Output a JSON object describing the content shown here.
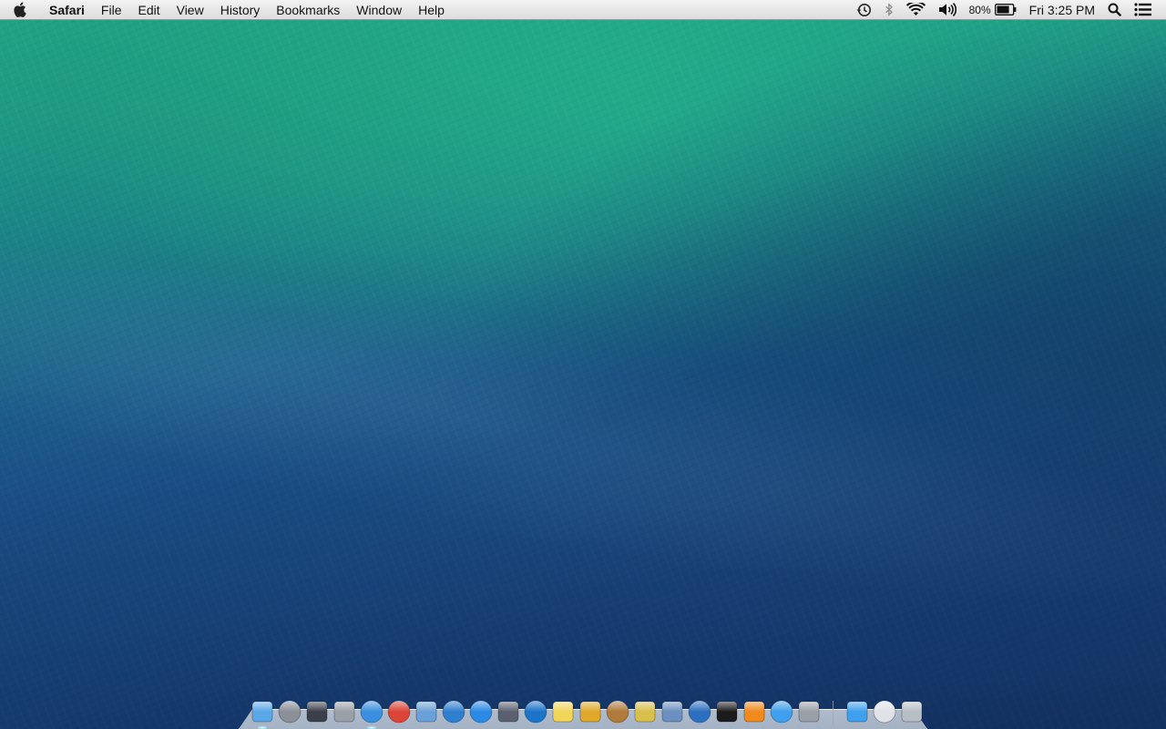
{
  "menubar": {
    "apple_icon": "apple-icon",
    "app_name": "Safari",
    "menus": [
      "File",
      "Edit",
      "View",
      "History",
      "Bookmarks",
      "Window",
      "Help"
    ],
    "status": {
      "time_machine_icon": "time-machine-icon",
      "bluetooth_icon": "bluetooth-icon",
      "wifi_icon": "wifi-icon",
      "volume_icon": "volume-icon",
      "battery_percent": "80%",
      "battery_level": 0.8,
      "clock": "Fri 3:25 PM",
      "spotlight_icon": "spotlight-search-icon",
      "notification_icon": "notification-center-icon"
    }
  },
  "dock": {
    "apps": [
      {
        "icon": "finder-icon",
        "running": true,
        "color": "#5aa7e8"
      },
      {
        "icon": "launchpad-icon",
        "running": false,
        "color": "#8a8f98"
      },
      {
        "icon": "mission-control-icon",
        "running": false,
        "color": "#3a3f4a"
      },
      {
        "icon": "system-preferences-icon",
        "running": false,
        "color": "#9aa0a8"
      },
      {
        "icon": "safari-icon",
        "running": true,
        "color": "#3b8fe0"
      },
      {
        "icon": "chrome-icon",
        "running": false,
        "color": "#db4437"
      },
      {
        "icon": "preview-icon",
        "running": false,
        "color": "#6aa0d8"
      },
      {
        "icon": "cloud-app-icon",
        "running": false,
        "color": "#2f7fd0"
      },
      {
        "icon": "itunes-icon",
        "running": false,
        "color": "#2a8ae6"
      },
      {
        "icon": "script-editor-icon",
        "running": false,
        "color": "#5a6070"
      },
      {
        "icon": "zoom-magnifier-icon",
        "running": false,
        "color": "#1c74c9"
      },
      {
        "icon": "stickies-icon",
        "running": false,
        "color": "#f2d65a"
      },
      {
        "icon": "pineapple-icon",
        "running": false,
        "color": "#e0a92a"
      },
      {
        "icon": "photo-app-icon",
        "running": false,
        "color": "#b07a3a"
      },
      {
        "icon": "imovie-icon",
        "running": false,
        "color": "#d8c04a"
      },
      {
        "icon": "virtualbox-icon",
        "running": false,
        "color": "#6b8fc0"
      },
      {
        "icon": "quicktime-icon",
        "running": false,
        "color": "#2c6fc0"
      },
      {
        "icon": "terminal-icon",
        "running": false,
        "color": "#1b1b1b"
      },
      {
        "icon": "vlc-icon",
        "running": false,
        "color": "#f08a1c"
      },
      {
        "icon": "app-store-icon",
        "running": false,
        "color": "#3ea0ee"
      },
      {
        "icon": "facetime-icon",
        "running": false,
        "color": "#9aa0a8"
      }
    ],
    "tray": [
      {
        "icon": "applications-folder-icon",
        "running": false,
        "color": "#3ea0ee"
      },
      {
        "icon": "downloads-stack-icon",
        "running": false,
        "color": "#dfe3e8"
      },
      {
        "icon": "trash-icon",
        "running": false,
        "color": "#b8bec6"
      }
    ]
  }
}
